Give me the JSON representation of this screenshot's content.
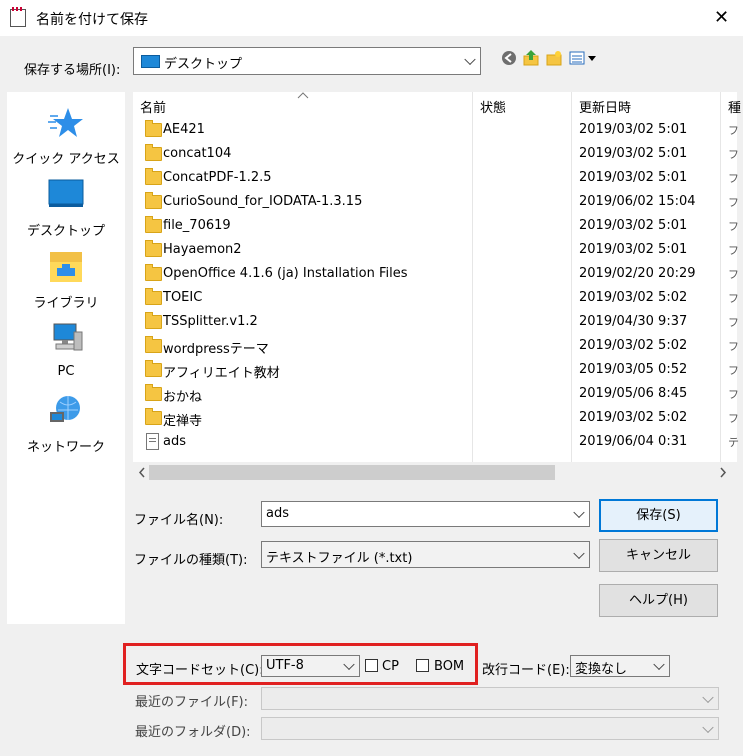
{
  "window": {
    "title": "名前を付けて保存",
    "close": "✕"
  },
  "location": {
    "label": "保存する場所(I):",
    "value": "デスクトップ"
  },
  "sidebar": {
    "items": [
      {
        "label": "クイック アクセス",
        "icon": "star-icon"
      },
      {
        "label": "デスクトップ",
        "icon": "desktop-icon"
      },
      {
        "label": "ライブラリ",
        "icon": "library-icon"
      },
      {
        "label": "PC",
        "icon": "pc-icon"
      },
      {
        "label": "ネットワーク",
        "icon": "network-icon"
      }
    ]
  },
  "filelist": {
    "columns": [
      "名前",
      "状態",
      "更新日時",
      "種"
    ],
    "rows": [
      {
        "name": "AE421",
        "date": "2019/03/02 5:01",
        "type": "フ",
        "kind": "folder"
      },
      {
        "name": "concat104",
        "date": "2019/03/02 5:01",
        "type": "フ",
        "kind": "folder"
      },
      {
        "name": "ConcatPDF-1.2.5",
        "date": "2019/03/02 5:01",
        "type": "フ",
        "kind": "folder"
      },
      {
        "name": "CurioSound_for_IODATA-1.3.15",
        "date": "2019/06/02 15:04",
        "type": "フ",
        "kind": "folder"
      },
      {
        "name": "file_70619",
        "date": "2019/03/02 5:01",
        "type": "フ",
        "kind": "folder"
      },
      {
        "name": "Hayaemon2",
        "date": "2019/03/02 5:01",
        "type": "フ",
        "kind": "folder"
      },
      {
        "name": "OpenOffice 4.1.6 (ja) Installation Files",
        "date": "2019/02/20 20:29",
        "type": "フ",
        "kind": "folder"
      },
      {
        "name": "TOEIC",
        "date": "2019/03/02 5:02",
        "type": "フ",
        "kind": "folder"
      },
      {
        "name": "TSSplitter.v1.2",
        "date": "2019/04/30 9:37",
        "type": "フ",
        "kind": "folder"
      },
      {
        "name": "wordpressテーマ",
        "date": "2019/03/02 5:02",
        "type": "フ",
        "kind": "folder"
      },
      {
        "name": "アフィリエイト教材",
        "date": "2019/03/05 0:52",
        "type": "フ",
        "kind": "folder"
      },
      {
        "name": "おかね",
        "date": "2019/05/06 8:45",
        "type": "フ",
        "kind": "folder"
      },
      {
        "name": "定禅寺",
        "date": "2019/03/02 5:02",
        "type": "フ",
        "kind": "folder"
      },
      {
        "name": "ads",
        "date": "2019/06/04 0:31",
        "type": "テ",
        "kind": "file"
      }
    ]
  },
  "form": {
    "filename_label": "ファイル名(N):",
    "filename_value": "ads",
    "filetype_label": "ファイルの種類(T):",
    "filetype_value": "テキストファイル (*.txt)",
    "save_label": "保存(S)",
    "cancel_label": "キャンセル",
    "help_label": "ヘルプ(H)",
    "encoding_label": "文字コードセット(C):",
    "encoding_value": "UTF-8",
    "cp_label": "CP",
    "bom_label": "BOM",
    "newline_label": "改行コード(E):",
    "newline_value": "変換なし",
    "recent_file_label": "最近のファイル(F):",
    "recent_folder_label": "最近のフォルダ(D):"
  },
  "colors": {
    "highlight": "#e02020",
    "accent": "#0078d7",
    "folder": "#f5c542"
  }
}
